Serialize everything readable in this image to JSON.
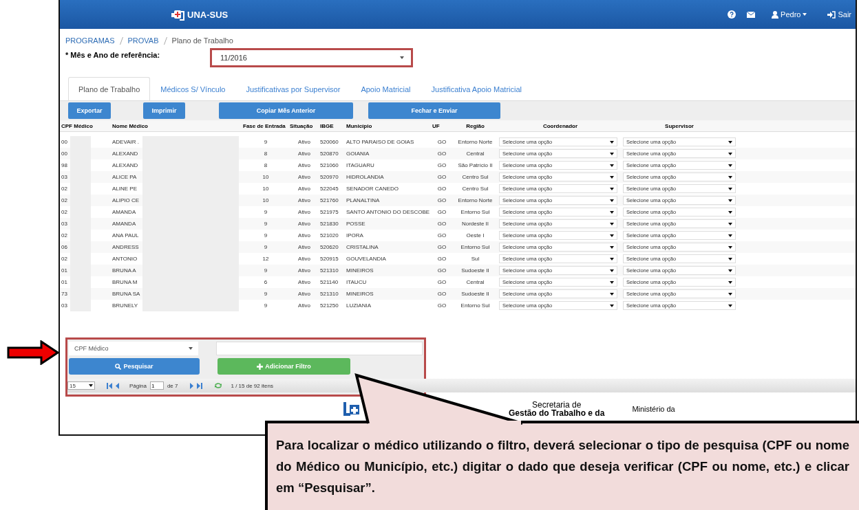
{
  "header": {
    "logo": "UNA-SUS",
    "user": "Pedro",
    "logout": "Sair"
  },
  "breadcrumb": [
    "PROGRAMAS",
    "PROVAB",
    "Plano de Trabalho"
  ],
  "reference": {
    "label": "* Mês e Ano de referência:",
    "value": "11/2016"
  },
  "tabs": [
    {
      "label": "Plano de Trabalho",
      "selected": true
    },
    {
      "label": "Médicos S/ Vínculo",
      "selected": false
    },
    {
      "label": "Justificativas por Supervisor",
      "selected": false
    },
    {
      "label": "Apoio Matricial",
      "selected": false
    },
    {
      "label": "Justificativa Apoio Matricial",
      "selected": false
    }
  ],
  "toolbar": [
    "Exportar",
    "Imprimir",
    "Copiar Mês Anterior",
    "Fechar e Enviar"
  ],
  "table": {
    "columns": [
      "CPF Médico",
      "Nome Médico",
      "Fase de Entrada",
      "Situação",
      "IBGE",
      "Município",
      "UF",
      "Região",
      "Coordenador",
      "Supervisor"
    ],
    "rows": [
      {
        "cpf": "00",
        "name": "ADEVAIR .",
        "fase": "9",
        "situacao": "Ativo",
        "ibge": "520060",
        "municipio": "ALTO PARAISO DE GOIAS",
        "uf": "GO",
        "regiao": "Entorno Norte",
        "coordenador": "Selecione uma opção",
        "supervisor": "Selecione uma opção"
      },
      {
        "cpf": "00",
        "name": "ALEXAND",
        "fase": "8",
        "situacao": "Ativo",
        "ibge": "520870",
        "municipio": "GOIANIA",
        "uf": "GO",
        "regiao": "Central",
        "coordenador": "Selecione uma opção",
        "supervisor": "Selecione uma opção"
      },
      {
        "cpf": "98",
        "name": "ALEXAND",
        "fase": "8",
        "situacao": "Ativo",
        "ibge": "521060",
        "municipio": "ITAGUARU",
        "uf": "GO",
        "regiao": "São Patrício II",
        "coordenador": "Selecione uma opção",
        "supervisor": "Selecione uma opção"
      },
      {
        "cpf": "03",
        "name": "ALICE PA",
        "fase": "10",
        "situacao": "Ativo",
        "ibge": "520970",
        "municipio": "HIDROLANDIA",
        "uf": "GO",
        "regiao": "Centro Sul",
        "coordenador": "Selecione uma opção",
        "supervisor": "Selecione uma opção"
      },
      {
        "cpf": "02",
        "name": "ALINE PE",
        "fase": "10",
        "situacao": "Ativo",
        "ibge": "522045",
        "municipio": "SENADOR CANEDO",
        "uf": "GO",
        "regiao": "Centro Sul",
        "coordenador": "Selecione uma opção",
        "supervisor": "Selecione uma opção"
      },
      {
        "cpf": "02",
        "name": "ALIPIO CE",
        "fase": "10",
        "situacao": "Ativo",
        "ibge": "521760",
        "municipio": "PLANALTINA",
        "uf": "GO",
        "regiao": "Entorno Norte",
        "coordenador": "Selecione uma opção",
        "supervisor": "Selecione uma opção"
      },
      {
        "cpf": "02",
        "name": "AMANDA",
        "fase": "9",
        "situacao": "Ativo",
        "ibge": "521975",
        "municipio": "SANTO ANTONIO DO DESCOBE",
        "uf": "GO",
        "regiao": "Entorno Sul",
        "coordenador": "Selecione uma opção",
        "supervisor": "Selecione uma opção"
      },
      {
        "cpf": "03",
        "name": "AMANDA",
        "fase": "9",
        "situacao": "Ativo",
        "ibge": "521830",
        "municipio": "POSSE",
        "uf": "GO",
        "regiao": "Nordeste II",
        "coordenador": "Selecione uma opção",
        "supervisor": "Selecione uma opção"
      },
      {
        "cpf": "02",
        "name": "ANA PAUL",
        "fase": "9",
        "situacao": "Ativo",
        "ibge": "521020",
        "municipio": "IPORA",
        "uf": "GO",
        "regiao": "Oeste I",
        "coordenador": "Selecione uma opção",
        "supervisor": "Selecione uma opção"
      },
      {
        "cpf": "06",
        "name": "ANDRESS",
        "fase": "9",
        "situacao": "Ativo",
        "ibge": "520620",
        "municipio": "CRISTALINA",
        "uf": "GO",
        "regiao": "Entorno Sul",
        "coordenador": "Selecione uma opção",
        "supervisor": "Selecione uma opção"
      },
      {
        "cpf": "02",
        "name": "ANTONIO",
        "fase": "12",
        "situacao": "Ativo",
        "ibge": "520915",
        "municipio": "GOUVELANDIA",
        "uf": "GO",
        "regiao": "Sul",
        "coordenador": "Selecione uma opção",
        "supervisor": "Selecione uma opção"
      },
      {
        "cpf": "01",
        "name": "BRUNA A",
        "fase": "9",
        "situacao": "Ativo",
        "ibge": "521310",
        "municipio": "MINEIROS",
        "uf": "GO",
        "regiao": "Sudoeste II",
        "coordenador": "Selecione uma opção",
        "supervisor": "Selecione uma opção"
      },
      {
        "cpf": "01",
        "name": "BRUNA M",
        "fase": "6",
        "situacao": "Ativo",
        "ibge": "521140",
        "municipio": "ITAUCU",
        "uf": "GO",
        "regiao": "Central",
        "coordenador": "Selecione uma opção",
        "supervisor": "Selecione uma opção"
      },
      {
        "cpf": "73",
        "name": "BRUNA SA",
        "fase": "9",
        "situacao": "Ativo",
        "ibge": "521310",
        "municipio": "MINEIROS",
        "uf": "GO",
        "regiao": "Sudoeste II",
        "coordenador": "Selecione uma opção",
        "supervisor": "Selecione uma opção"
      },
      {
        "cpf": "03",
        "name": "BRUNELY",
        "fase": "9",
        "situacao": "Ativo",
        "ibge": "521250",
        "municipio": "LUZIANIA",
        "uf": "GO",
        "regiao": "Entorno Sul",
        "coordenador": "Selecione uma opção",
        "supervisor": "Selecione uma opção"
      }
    ]
  },
  "filter": {
    "field": "CPF Médico",
    "search_button": "Pesquisar",
    "add_button": "Adicionar Filtro"
  },
  "pager": {
    "page_size": "15",
    "page_label": "Página",
    "page": "1",
    "of": "de 7",
    "summary": "1 / 15 de 92 itens"
  },
  "footer": {
    "secretaria": [
      "Secretaria de",
      "Gestão do Trabalho e da"
    ],
    "ministerio": "Ministério da"
  },
  "callout": {
    "text": "Para localizar o médico utilizando o filtro, deverá selecionar o tipo de pesquisa (CPF ou nome do Médico ou Município, etc.) digitar o dado que deseja verificar (CPF ou nome, etc.) e clicar em “Pesquisar”."
  }
}
